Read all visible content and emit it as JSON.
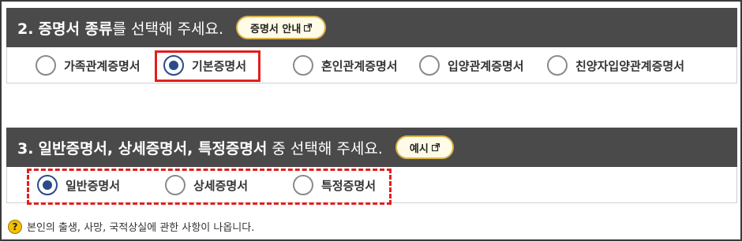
{
  "section2": {
    "number": "2.",
    "title_bold": "증명서 종류",
    "title_rest": "를 선택해 주세요.",
    "info_button": "증명서 안내",
    "options": [
      {
        "label": "가족관계증명서",
        "checked": false
      },
      {
        "label": "기본증명서",
        "checked": true
      },
      {
        "label": "혼인관계증명서",
        "checked": false
      },
      {
        "label": "입양관계증명서",
        "checked": false
      },
      {
        "label": "친양자입양관계증명서",
        "checked": false
      }
    ]
  },
  "section3": {
    "number": "3.",
    "title_bold": "일반증명서, 상세증명서, 특정증명서",
    "title_rest": " 중 선택해 주세요.",
    "info_button": "예시",
    "options": [
      {
        "label": "일반증명서",
        "checked": true
      },
      {
        "label": "상세증명서",
        "checked": false
      },
      {
        "label": "특정증명서",
        "checked": false
      }
    ]
  },
  "note": {
    "icon": "?",
    "text": "본인의 출생, 사망, 국적상실에 관한 사항이 나옵니다."
  },
  "colors": {
    "header_bg": "#4a4a4a",
    "highlight": "#e0201b",
    "radio_selected": "#2b4a8c",
    "button_border": "#d8b24a"
  }
}
